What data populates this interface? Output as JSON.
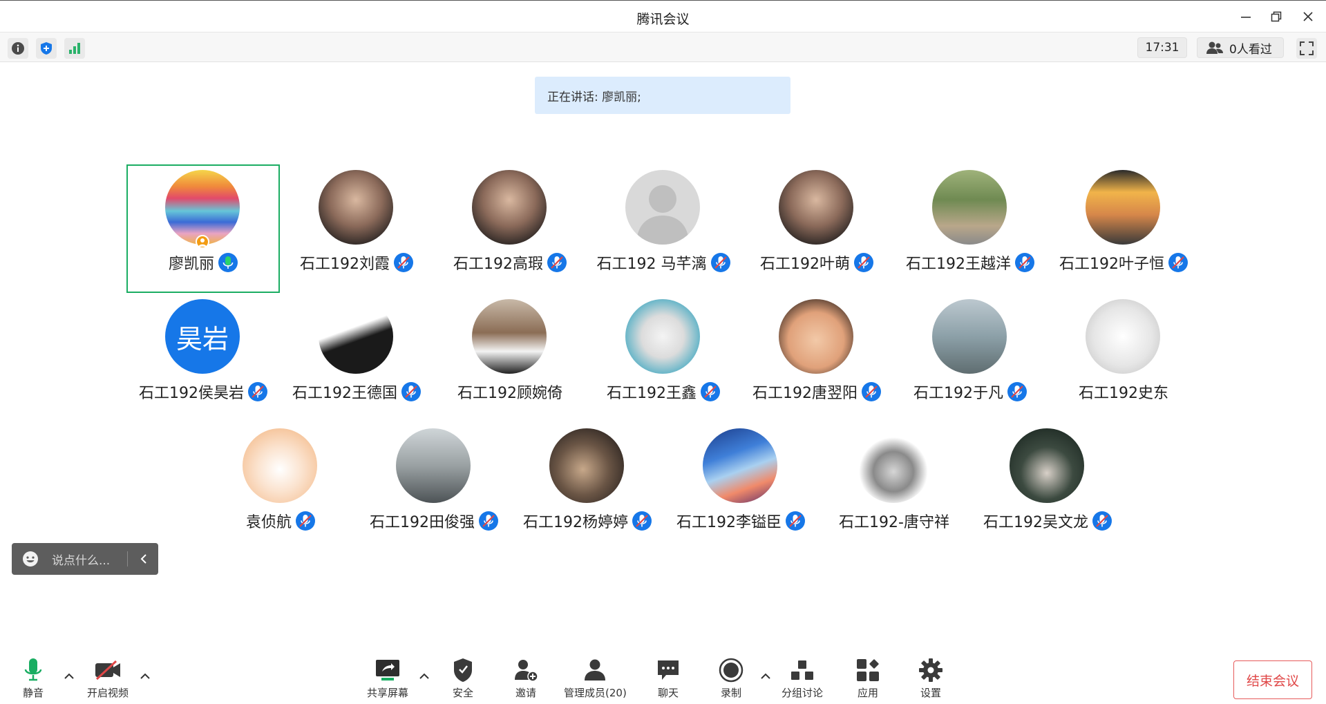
{
  "window": {
    "title": "腾讯会议"
  },
  "infobar": {
    "time": "17:31",
    "viewers": "0人看过"
  },
  "speaking": {
    "text": "正在讲话: 廖凯丽;"
  },
  "participants": [
    {
      "name": "廖凯丽",
      "mic": "speaking",
      "avatar": "rainbow-avatar",
      "active": true
    },
    {
      "name": "石工192刘霞",
      "mic": "muted",
      "avatar": "photo-girl-avatar"
    },
    {
      "name": "石工192高瑕",
      "mic": "muted",
      "avatar": "photo-girl-avatar"
    },
    {
      "name": "石工192 马芊漓",
      "mic": "muted",
      "avatar": "default-person-avatar"
    },
    {
      "name": "石工192叶萌",
      "mic": "muted",
      "avatar": "photo-girl-avatar"
    },
    {
      "name": "石工192王越洋",
      "mic": "muted",
      "avatar": "photo-outdoor-avatar"
    },
    {
      "name": "石工192叶子恒",
      "mic": "muted",
      "avatar": "cartoon-avatar"
    },
    {
      "name": "石工192侯昊岩",
      "mic": "muted",
      "avatar": "text-avatar",
      "avatar_text": "昊岩"
    },
    {
      "name": "石工192王德国",
      "mic": "muted",
      "avatar": "anime-avatar"
    },
    {
      "name": "石工192顾婉倚",
      "mic": "none",
      "avatar": "photo-boy-avatar"
    },
    {
      "name": "石工192王鑫",
      "mic": "muted",
      "avatar": "cat-avatar"
    },
    {
      "name": "石工192唐翌阳",
      "mic": "muted",
      "avatar": "photo-child-avatar"
    },
    {
      "name": "石工192于凡",
      "mic": "muted",
      "avatar": "photo-building-avatar"
    },
    {
      "name": "石工192史东",
      "mic": "none",
      "avatar": "sketch-avatar"
    },
    {
      "name": "袁侦航",
      "mic": "muted",
      "avatar": "cartoon-heart-avatar"
    },
    {
      "name": "石工192田俊强",
      "mic": "muted",
      "avatar": "photo-street-avatar"
    },
    {
      "name": "石工192杨婷婷",
      "mic": "muted",
      "avatar": "photo-hand-avatar"
    },
    {
      "name": "石工192李镒臣",
      "mic": "muted",
      "avatar": "art-sky-avatar"
    },
    {
      "name": "石工192-唐守祥",
      "mic": "none",
      "avatar": "meme-avatar"
    },
    {
      "name": "石工192吴文龙",
      "mic": "muted",
      "avatar": "anime-boy-avatar"
    }
  ],
  "chat": {
    "placeholder": "说点什么..."
  },
  "toolbar": {
    "mute": "静音",
    "video": "开启视频",
    "share": "共享屏幕",
    "security": "安全",
    "invite": "邀请",
    "members": "管理成员(20)",
    "chat": "聊天",
    "record": "录制",
    "breakout": "分组讨论",
    "apps": "应用",
    "settings": "设置",
    "end": "结束会议"
  },
  "colors": {
    "accent": "#1677e8",
    "active_border": "#1aad62",
    "end": "#e04747",
    "banner": "#dcecfd"
  }
}
